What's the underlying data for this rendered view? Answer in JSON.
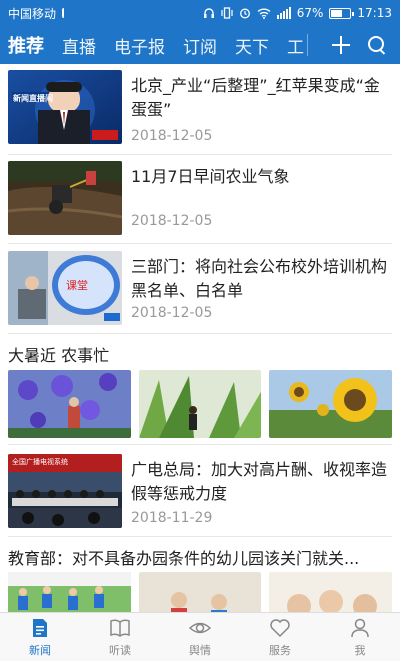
{
  "status_bar": {
    "carrier": "中国移动",
    "battery": "67%",
    "battery_level": 0.67,
    "time": "17:13"
  },
  "nav": {
    "tabs": [
      {
        "label": "推荐",
        "active": true
      },
      {
        "label": "直播",
        "active": false
      },
      {
        "label": "电子报",
        "active": false
      },
      {
        "label": "订阅",
        "active": false
      },
      {
        "label": "天下",
        "active": false
      },
      {
        "label": "工",
        "active": false
      }
    ],
    "icons": [
      "plus-icon",
      "search-icon"
    ]
  },
  "feed": {
    "items": [
      {
        "title": "北京_产业“后整理”_红苹果变成“金蛋蛋”",
        "date": "2018-12-05",
        "thumb_label": "新闻直播间"
      },
      {
        "title": "11月7日早间农业气象",
        "date": "2018-12-05"
      },
      {
        "title": "三部门：将向社会公布校外培训机构黑名单、白名单",
        "date": "2018-12-05"
      }
    ],
    "gallery": {
      "title": "大暑近 农事忙"
    },
    "item4": {
      "title": "广电总局：加大对高片酬、收视率造假等惩戒力度",
      "date": "2018-11-29",
      "banner": "全国广播电视系统"
    },
    "item5": {
      "title": "教育部：对不具备办园条件的幼儿园该关门就关..."
    }
  },
  "bottom_bar": {
    "items": [
      {
        "label": "新闻",
        "icon": "news-doc-icon",
        "active": true
      },
      {
        "label": "听读",
        "icon": "book-icon",
        "active": false
      },
      {
        "label": "舆情",
        "icon": "eye-icon",
        "active": false
      },
      {
        "label": "服务",
        "icon": "heart-icon",
        "active": false
      },
      {
        "label": "我",
        "icon": "person-icon",
        "active": false
      }
    ]
  },
  "colors": {
    "brand": "#1f75c8",
    "active_tab_icon": "#1f75c8",
    "inactive": "#888888"
  }
}
